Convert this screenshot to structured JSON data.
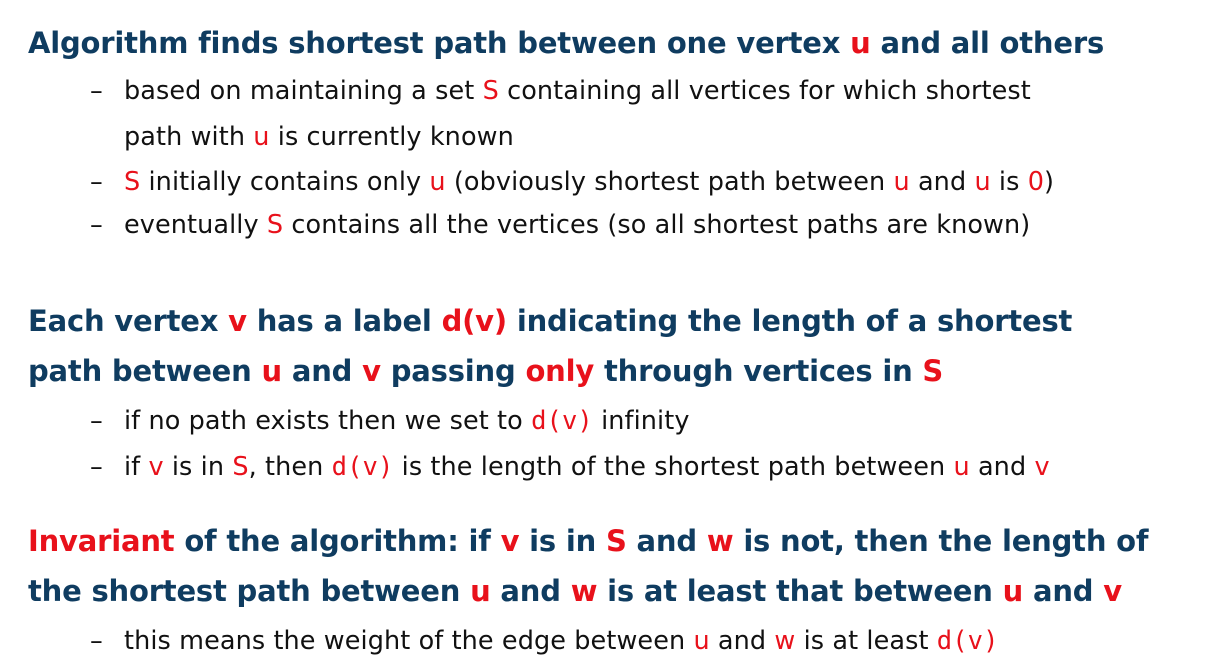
{
  "sections": [
    {
      "heading_lines": [
        [
          "Algorithm finds shortest path between one vertex ",
          {
            "hl": "u"
          },
          " and all others"
        ]
      ],
      "bullets": [
        {
          "lines": [
            [
              "based on maintaining a set ",
              {
                "hl": "S"
              },
              " containing all vertices for which shortest"
            ],
            [
              "path with ",
              {
                "hl": "u"
              },
              " is currently known"
            ]
          ]
        },
        {
          "lines": [
            [
              {
                "hl": "S"
              },
              " initially contains only ",
              {
                "hl": "u"
              },
              " (obviously shortest path between ",
              {
                "hl": "u"
              },
              " and ",
              {
                "hl": "u"
              },
              " is ",
              {
                "hl": "0"
              },
              ")"
            ]
          ]
        },
        {
          "lines": [
            [
              "eventually ",
              {
                "hl": "S"
              },
              " contains all the vertices (so all shortest paths are known)"
            ]
          ]
        }
      ]
    },
    {
      "heading_lines": [
        [
          "Each vertex ",
          {
            "hl": "v"
          },
          " has a label ",
          {
            "hl": "d(v)"
          },
          " indicating the length of a shortest"
        ],
        [
          "path between ",
          {
            "hl": "u"
          },
          " and ",
          {
            "hl": "v"
          },
          " passing ",
          {
            "hl": "only"
          },
          " through vertices in ",
          {
            "hl": "S"
          }
        ]
      ],
      "bullets": [
        {
          "lines": [
            [
              "if no path exists then we set to ",
              {
                "hl": "d(v)",
                "mono": true
              },
              " infinity"
            ]
          ]
        },
        {
          "lines": [
            [
              "if ",
              {
                "hl": "v"
              },
              " is in ",
              {
                "hl": "S"
              },
              ", then ",
              {
                "hl": "d(v)",
                "mono": true
              },
              " is the length of the shortest path between ",
              {
                "hl": "u"
              },
              " and ",
              {
                "hl": "v"
              }
            ]
          ]
        }
      ]
    },
    {
      "heading_lines": [
        [
          {
            "hl": "Invariant"
          },
          " of the algorithm: if ",
          {
            "hl": "v"
          },
          " is in ",
          {
            "hl": "S"
          },
          " and ",
          {
            "hl": "w"
          },
          " is not, then the length of"
        ],
        [
          "the shortest path between ",
          {
            "hl": "u"
          },
          " and ",
          {
            "hl": "w"
          },
          " is at least that between ",
          {
            "hl": "u"
          },
          " and ",
          {
            "hl": "v"
          }
        ]
      ],
      "bullets": [
        {
          "lines": [
            [
              "this means the weight of the edge between ",
              {
                "hl": "u"
              },
              " and ",
              {
                "hl": "w"
              },
              " is at least ",
              {
                "hl": "d(v)",
                "mono": true
              }
            ]
          ]
        }
      ]
    }
  ],
  "bullet_marker": "–",
  "colors": {
    "heading": "#0f3c60",
    "body": "#111111",
    "highlight": "#e8111b",
    "background": "#ffffff"
  }
}
